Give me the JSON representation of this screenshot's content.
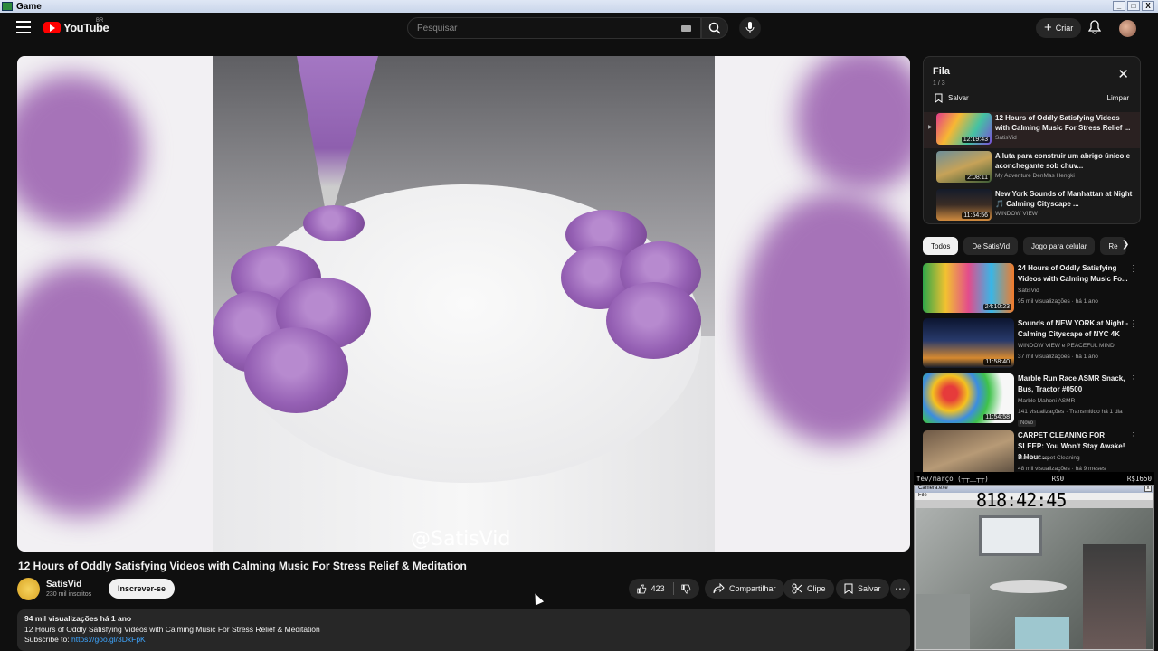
{
  "window": {
    "title": "Game",
    "buttons": [
      "_",
      "□",
      "X"
    ]
  },
  "header": {
    "logo_text": "YouTube",
    "region": "BR",
    "search_placeholder": "Pesquisar",
    "create_label": "Criar"
  },
  "video": {
    "watermark": "@SatisVid",
    "title": "12 Hours of Oddly Satisfying Videos with Calming Music For Stress Relief & Meditation",
    "channel": "SatisVid",
    "subscribers": "230 mil inscritos",
    "subscribe_label": "Inscrever-se",
    "likes": "423",
    "share_label": "Compartilhar",
    "clip_label": "Clipe",
    "save_label": "Salvar",
    "description": {
      "stats": "94 mil visualizações  há 1 ano",
      "line1": "12 Hours of Oddly Satisfying Videos with Calming Music For Stress Relief & Meditation",
      "line2_prefix": "Subscribe to: ",
      "link": "https://goo.gl/3DkFpK"
    }
  },
  "queue": {
    "title": "Fila",
    "count": "1 / 3",
    "save_label": "Salvar",
    "clear_label": "Limpar",
    "items": [
      {
        "title": "12 Hours of Oddly Satisfying Videos with Calming Music For Stress Relief ...",
        "channel": "SatisVid",
        "duration": "12:19:43"
      },
      {
        "title": "A luta para construir um abrigo único e aconchegante sob chuv...",
        "channel": "My Adventure DenMas Hengki",
        "duration": "2:08:11"
      },
      {
        "title": "New York Sounds of Manhattan at Night 🎵 Calming Cityscape ...",
        "channel": "WINDOW VIEW",
        "duration": "11:54:56"
      }
    ]
  },
  "chips": [
    "Todos",
    "De SatisVid",
    "Jogo para celular",
    "Re"
  ],
  "recommendations": [
    {
      "title": "24 Hours of Oddly Satisfying Videos with Calming Music Fo...",
      "channel": "SatisVid",
      "meta": "95 mil visualizações · há 1 ano",
      "duration": "24:10:23",
      "badge": ""
    },
    {
      "title": "Sounds of NEW YORK at Night - Calming Cityscape of NYC 4K",
      "channel": "WINDOW VIEW e PEACEFUL MIND",
      "meta": "37 mil visualizações · há 1 ano",
      "duration": "11:58:40",
      "badge": ""
    },
    {
      "title": "Marble Run Race ASMR Snack, Bus, Tractor #0500",
      "channel": "Marble Mahoni ASMR",
      "meta": "141 visualizações · Transmitido há 1 dia",
      "duration": "11:54:58",
      "badge": "Novo"
    },
    {
      "title": "CARPET CLEANING FOR SLEEP: You Won't Stay Awake! 8 Hour ...",
      "channel": "Master Carpet Cleaning",
      "meta": "48 mil visualizações · há 9 meses",
      "duration": "",
      "badge": ""
    }
  ],
  "overlay": {
    "left": "fev/março (┬┬﹏┬┬)",
    "mid": "R$0",
    "right": "R$1650",
    "cam_title": "Camera.exe",
    "cam_menu": "File",
    "clock": "818:42:45"
  }
}
